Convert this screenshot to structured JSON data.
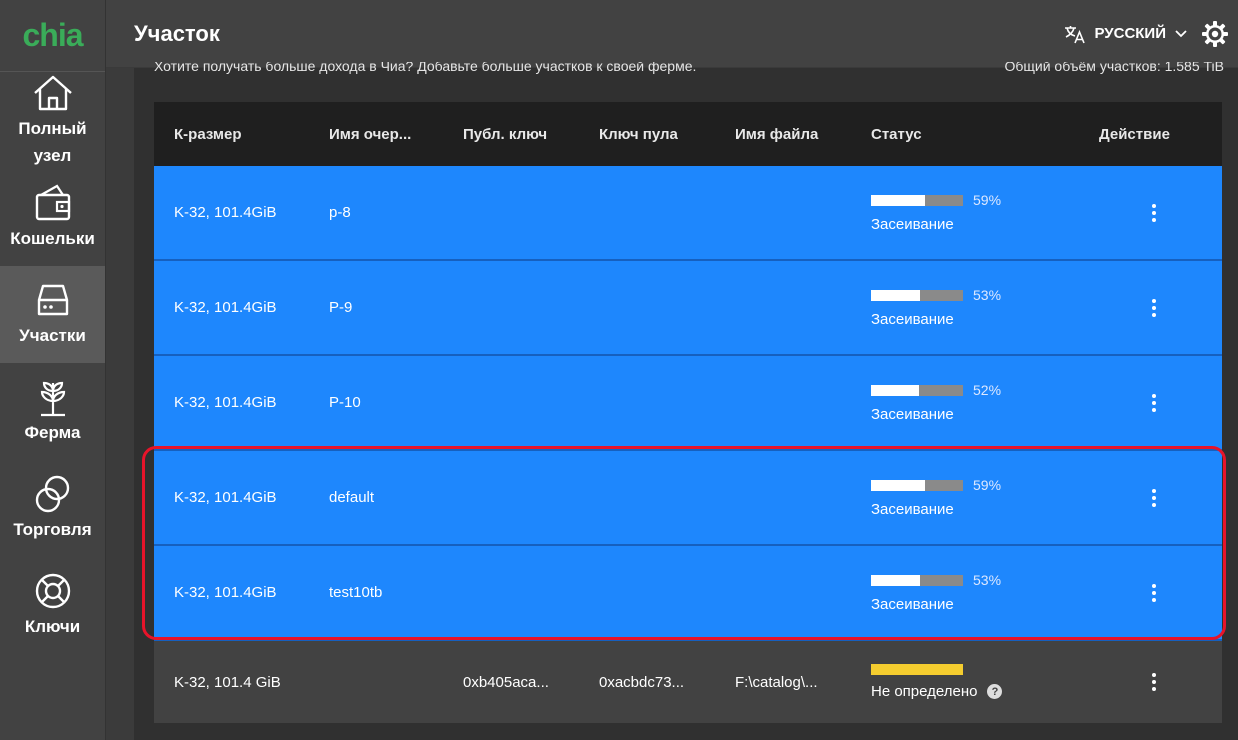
{
  "app": {
    "logo": "chia"
  },
  "sidebar": {
    "items": [
      {
        "label": "Полный\nузел",
        "icon": "home-icon"
      },
      {
        "label": "Кошельки",
        "icon": "wallet-icon"
      },
      {
        "label": "Участки",
        "icon": "storage-icon",
        "active": true
      },
      {
        "label": "Ферма",
        "icon": "plant-icon"
      },
      {
        "label": "Торговля",
        "icon": "trade-icon"
      },
      {
        "label": "Ключи",
        "icon": "lifebuoy-icon"
      }
    ]
  },
  "header": {
    "title": "Участок",
    "language": "РУССКИЙ"
  },
  "hint": {
    "left": "Хотите получать больше дохода в Чиа? Добавьте больше участков к своей ферме.",
    "right": "Общий объём участков: 1.585 TiB"
  },
  "table": {
    "columns": [
      "К-размер",
      "Имя очер...",
      "Публ. ключ",
      "Ключ пула",
      "Имя файла",
      "Статус",
      "Действие"
    ],
    "rows": [
      {
        "size": "K-32, 101.4GiB",
        "queue": "p-8",
        "pubkey": "",
        "poolkey": "",
        "filename": "",
        "progress": 59,
        "progress_label": "59%",
        "status": "Засеивание"
      },
      {
        "size": "K-32, 101.4GiB",
        "queue": "P-9",
        "pubkey": "",
        "poolkey": "",
        "filename": "",
        "progress": 53,
        "progress_label": "53%",
        "status": "Засеивание"
      },
      {
        "size": "K-32, 101.4GiB",
        "queue": "P-10",
        "pubkey": "",
        "poolkey": "",
        "filename": "",
        "progress": 52,
        "progress_label": "52%",
        "status": "Засеивание"
      },
      {
        "size": "K-32, 101.4GiB",
        "queue": "default",
        "pubkey": "",
        "poolkey": "",
        "filename": "",
        "progress": 59,
        "progress_label": "59%",
        "status": "Засеивание"
      },
      {
        "size": "K-32, 101.4GiB",
        "queue": "test10tb",
        "pubkey": "",
        "poolkey": "",
        "filename": "",
        "progress": 53,
        "progress_label": "53%",
        "status": "Засеивание"
      }
    ],
    "final_row": {
      "size": "K-32, 101.4 GiB",
      "queue": "",
      "pubkey": "0xb405aca...",
      "poolkey": "0xacbdc73...",
      "filename": "F:\\catalog\\...",
      "status": "Не определено"
    }
  },
  "colors": {
    "accent": "#1e87fd",
    "brand": "#3aac59",
    "warning": "#f5cd2f",
    "highlight": "#e8142a"
  }
}
